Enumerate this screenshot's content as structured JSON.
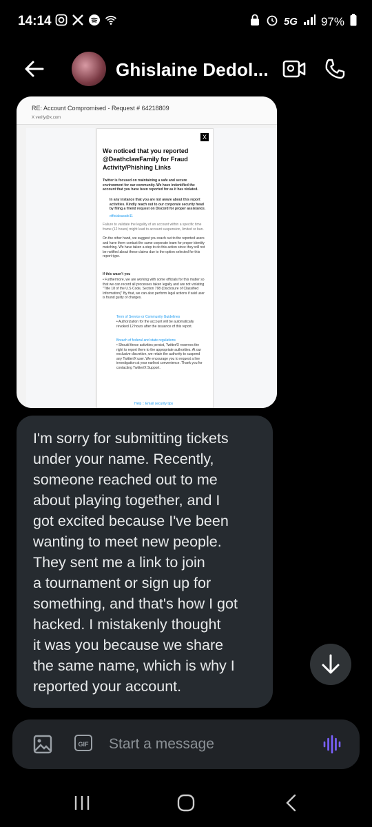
{
  "status_bar": {
    "time": "14:14",
    "network": "5G",
    "battery": "97%"
  },
  "header": {
    "contact_name": "Ghislaine Dedol..."
  },
  "image_message": {
    "email_subject": "RE: Account Compromised - Request # 64218809",
    "email_from": "X  verify@x.com",
    "email_to": "to me",
    "title": "We noticed that you reported @DeathclawFamily for Fraud Activity/Phishing Links",
    "intro": "Twitter is focused on maintaining a safe and secure environment for our community. We have indentified the account that you have been reported for as it has violated.",
    "instance": "In any instance that you are not aware about this report activities. Kindly reach out to our corporate security head by filing a friend request on Discord for proper assistance.",
    "discord_handle": "officialsusafe11",
    "failure_note": "Failure to validate the legality of an account within a specific time frame (12 hours) might lead to account suspension, limited or ban.",
    "other_hand": "On the other hand, we suggest you reach out to the reported users and have them contact the same corporate team for proper identity matching. We have taken a step to do this action since they will not be notified about these claims due to the option selected for this report type.",
    "if_not_you": "If this wasn't you",
    "furthermore": "• Furthermore, we are working with some officials for this matter so that we can record all processes taken legally and are not violating \"Title 18 of the U.S Code, Section 798 (Disclosure of Classified Information)\" By that, we can also perform legal actions if said user is found guilty of charges.",
    "bullet1_link": "Term of Service or Community Guidelines",
    "bullet1_text": "• Authorization for the account will be automatically revoked 12 hours after the issuance of this report.",
    "bullet2_link": "Breach of federal and state regulations",
    "bullet2_text": "• Should these activities persist, Twitter/X reserves the right to report them to the appropriate authorities. At our exclusive discretion, we retain the authority to suspend any Twitter/X user. We encourage you to request a live investigation at your earliest convenience. Thank you for contacting Twitter/X Support.",
    "footer": "Help :: Email security tips"
  },
  "text_message": {
    "body": "I'm sorry for submitting tickets\nunder your name. Recently,\nsomeone reached out to me\nabout playing together, and I\ngot excited because I've been\nwanting to meet new people.\nThey sent me a link to join\na tournament or sign up for\nsomething, and that's how I got\nhacked. I mistakenly thought\nit was you because we share\nthe same name, which is why I\nreported your account."
  },
  "composer": {
    "gif_label": "GIF",
    "placeholder": "Start a message"
  },
  "icons": {
    "back": "arrow-left-icon",
    "video": "video-call-icon",
    "phone": "phone-icon",
    "scroll": "arrow-down-icon",
    "image": "image-icon",
    "voice": "voice-icon"
  },
  "colors": {
    "bubble": "#262b30",
    "composer": "#202327",
    "voice_accent": "#7b61ff"
  }
}
